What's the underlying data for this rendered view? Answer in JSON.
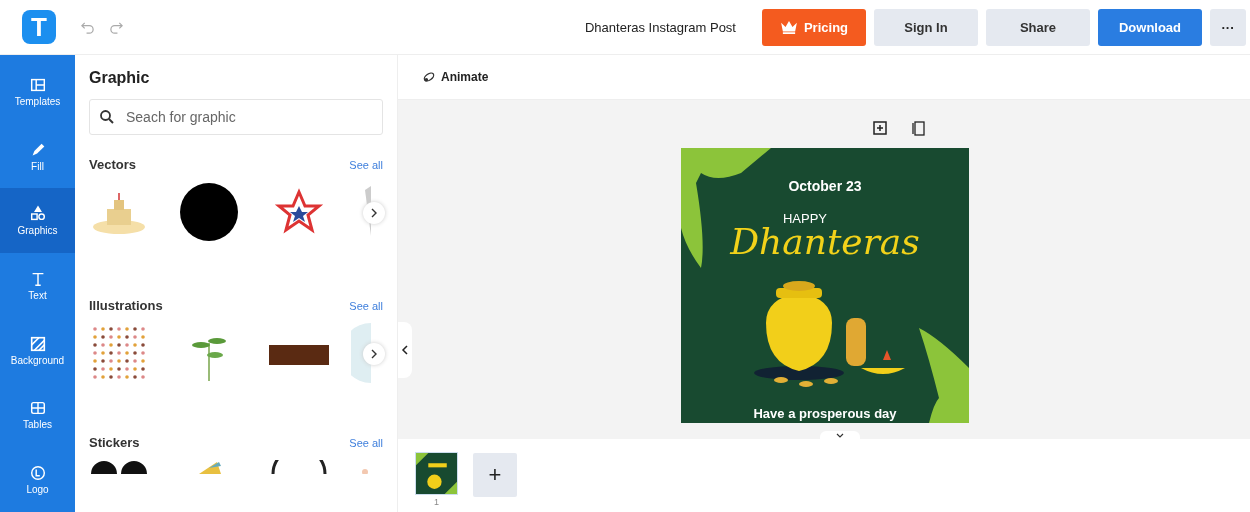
{
  "logo": {
    "letter": "T"
  },
  "header": {
    "document_title": "Dhanteras Instagram Post",
    "buttons": [
      {
        "label": "Pricing",
        "kind": "pricing"
      },
      {
        "label": "Sign In",
        "kind": "plain"
      },
      {
        "label": "Share",
        "kind": "plain"
      },
      {
        "label": "Download",
        "kind": "primary"
      },
      {
        "label": "···",
        "kind": "more"
      }
    ]
  },
  "sidebar": {
    "items": [
      {
        "label": "Templates",
        "kind": "templates",
        "selected": false
      },
      {
        "label": "Fill",
        "kind": "fill",
        "selected": false
      },
      {
        "label": "Graphics",
        "kind": "graphics",
        "selected": true
      },
      {
        "label": "Text",
        "kind": "text",
        "selected": false
      },
      {
        "label": "Background",
        "kind": "background",
        "selected": false
      },
      {
        "label": "Tables",
        "kind": "tables",
        "selected": false
      },
      {
        "label": "Logo",
        "kind": "logo",
        "selected": false
      }
    ]
  },
  "panel": {
    "title": "Graphic",
    "search": {
      "placeholder": "Seach for graphic"
    },
    "sections": [
      {
        "title": "Vectors",
        "link": "See all",
        "kind": "vectors"
      },
      {
        "title": "Illustrations",
        "link": "See all",
        "kind": "illustrations"
      },
      {
        "title": "Stickers",
        "link": "See all",
        "kind": "stickers"
      }
    ]
  },
  "toolbar": {
    "animate": "Animate"
  },
  "design": {
    "date": "October 23",
    "happy": "HAPPY",
    "title": "Dhanteras",
    "tagline": "Have a prosperous day"
  },
  "pages": {
    "thumbnails": [
      {
        "number": "1",
        "selected": true
      }
    ],
    "add": "+"
  }
}
